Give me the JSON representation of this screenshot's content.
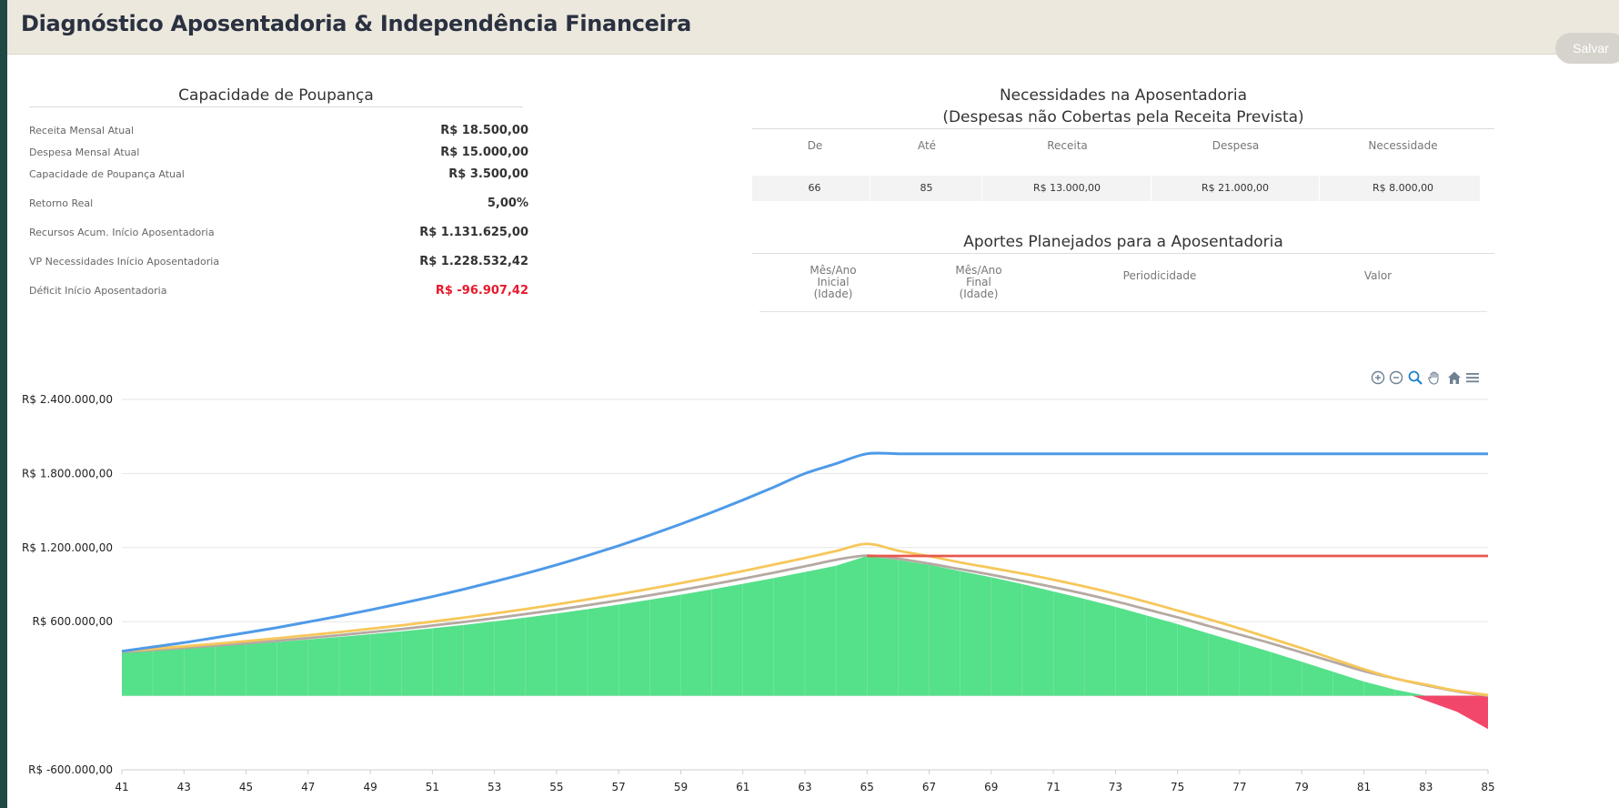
{
  "header": {
    "title": "Diagnóstico Aposentadoria & Independência Financeira",
    "save_label": "Salvar"
  },
  "capacidade": {
    "title": "Capacidade de Poupança",
    "rows": [
      {
        "label": "Receita Mensal Atual",
        "value": "R$ 18.500,00"
      },
      {
        "label": "Despesa Mensal Atual",
        "value": "R$ 15.000,00"
      },
      {
        "label": "Capacidade de Poupança Atual",
        "value": "R$ 3.500,00"
      },
      {
        "label": "Retorno Real",
        "value": "5,00%"
      },
      {
        "label": "Recursos Acum. Início Aposentadoria",
        "value": "R$ 1.131.625,00"
      },
      {
        "label": "VP Necessidades Início Aposentadoria",
        "value": "R$ 1.228.532,42"
      },
      {
        "label": "Déficit Início Aposentadoria",
        "value": "R$ -96.907,42"
      }
    ]
  },
  "necessidades": {
    "title_line1": "Necessidades na Aposentadoria",
    "title_line2": "(Despesas não Cobertas pela Receita Prevista)",
    "headers": [
      "De",
      "Até",
      "Receita",
      "Despesa",
      "Necessidade"
    ],
    "row": [
      "66",
      "85",
      "R$  13.000,00",
      "R$  21.000,00",
      "R$  8.000,00"
    ]
  },
  "aportes": {
    "title": "Aportes Planejados para a Aposentadoria",
    "headers": [
      "Mês/Ano\nInicial\n(Idade)",
      "Mês/Ano\nFinal\n(Idade)",
      "Periodicidade",
      "Valor"
    ]
  },
  "toolbar": {
    "icons": [
      "zoom-in-icon",
      "zoom-out-icon",
      "selection-zoom-icon",
      "pan-icon",
      "home-icon",
      "menu-icon"
    ]
  },
  "chart_data": {
    "type": "area",
    "title": "",
    "xlabel": "",
    "ylabel": "",
    "x": [
      41,
      42,
      43,
      44,
      45,
      46,
      47,
      48,
      49,
      50,
      51,
      52,
      53,
      54,
      55,
      56,
      57,
      58,
      59,
      60,
      61,
      62,
      63,
      64,
      65,
      66,
      67,
      68,
      69,
      70,
      71,
      72,
      73,
      74,
      75,
      76,
      77,
      78,
      79,
      80,
      81,
      82,
      83,
      84,
      85
    ],
    "xticks": [
      41,
      43,
      45,
      47,
      49,
      51,
      53,
      55,
      57,
      59,
      61,
      63,
      65,
      67,
      69,
      71,
      73,
      75,
      77,
      79,
      81,
      83,
      85
    ],
    "yticks": [
      "R$ 2.400.000,00",
      "R$ 1.800.000,00",
      "R$ 1.200.000,00",
      "R$ 600.000,00",
      "R$ -600.000,00"
    ],
    "ylim": [
      -600000,
      2400000
    ],
    "grid": true,
    "series": [
      {
        "color": "#4f9ae8",
        "values": [
          360000,
          395000,
          430000,
          470000,
          510000,
          552000,
          598000,
          645000,
          695000,
          748000,
          803000,
          862000,
          925000,
          990000,
          1060000,
          1135000,
          1215000,
          1300000,
          1390000,
          1485000,
          1585000,
          1690000,
          1800000,
          1880000,
          1960000,
          1960000,
          1960000,
          1960000,
          1960000,
          1960000,
          1960000,
          1960000,
          1960000,
          1960000,
          1960000,
          1960000,
          1960000,
          1960000,
          1960000,
          1960000,
          1960000,
          1960000,
          1960000,
          1960000,
          1960000
        ]
      },
      {
        "color": "#e8584c",
        "values": [
          null,
          null,
          null,
          null,
          null,
          null,
          null,
          null,
          null,
          null,
          null,
          null,
          null,
          null,
          null,
          null,
          null,
          null,
          null,
          null,
          null,
          null,
          null,
          null,
          1132000,
          1132000,
          1132000,
          1132000,
          1132000,
          1132000,
          1132000,
          1132000,
          1132000,
          1132000,
          1132000,
          1132000,
          1132000,
          1132000,
          1132000,
          1132000,
          1132000,
          1132000,
          1132000,
          1132000,
          1132000
        ]
      },
      {
        "color": "#f6c75a",
        "values": [
          360000,
          380000,
          400000,
          420000,
          442000,
          465000,
          490000,
          515000,
          542000,
          570000,
          600000,
          632000,
          666000,
          702000,
          740000,
          780000,
          822000,
          866000,
          912000,
          960000,
          1010000,
          1062000,
          1116000,
          1172000,
          1230000,
          1175000,
          1130000,
          1080000,
          1035000,
          990000,
          940000,
          885000,
          825000,
          760000,
          690000,
          620000,
          545000,
          465000,
          385000,
          300000,
          215000,
          140000,
          90000,
          40000,
          5000
        ]
      },
      {
        "color": "#b5a9a2",
        "values": [
          355000,
          370000,
          388000,
          405000,
          425000,
          445000,
          467000,
          490000,
          515000,
          540000,
          568000,
          597000,
          628000,
          661000,
          696000,
          733000,
          772000,
          813000,
          856000,
          901000,
          948000,
          997000,
          1048000,
          1101000,
          1135000,
          1110000,
          1070000,
          1025000,
          980000,
          930000,
          880000,
          825000,
          765000,
          700000,
          635000,
          565000,
          495000,
          425000,
          350000,
          275000,
          200000,
          140000,
          85000,
          35000,
          0
        ]
      },
      {
        "color": "#55e08a",
        "values": [
          350000,
          365000,
          380000,
          398000,
          416000,
          435000,
          455000,
          476000,
          498000,
          521000,
          546000,
          573000,
          602000,
          633000,
          666000,
          701000,
          738000,
          777000,
          818000,
          861000,
          906000,
          953000,
          1002000,
          1053000,
          1132000,
          1100000,
          1060000,
          1010000,
          960000,
          905000,
          845000,
          785000,
          720000,
          650000,
          580000,
          505000,
          430000,
          355000,
          275000,
          195000,
          115000,
          50000,
          -40000,
          -130000,
          -270000
        ]
      }
    ]
  }
}
